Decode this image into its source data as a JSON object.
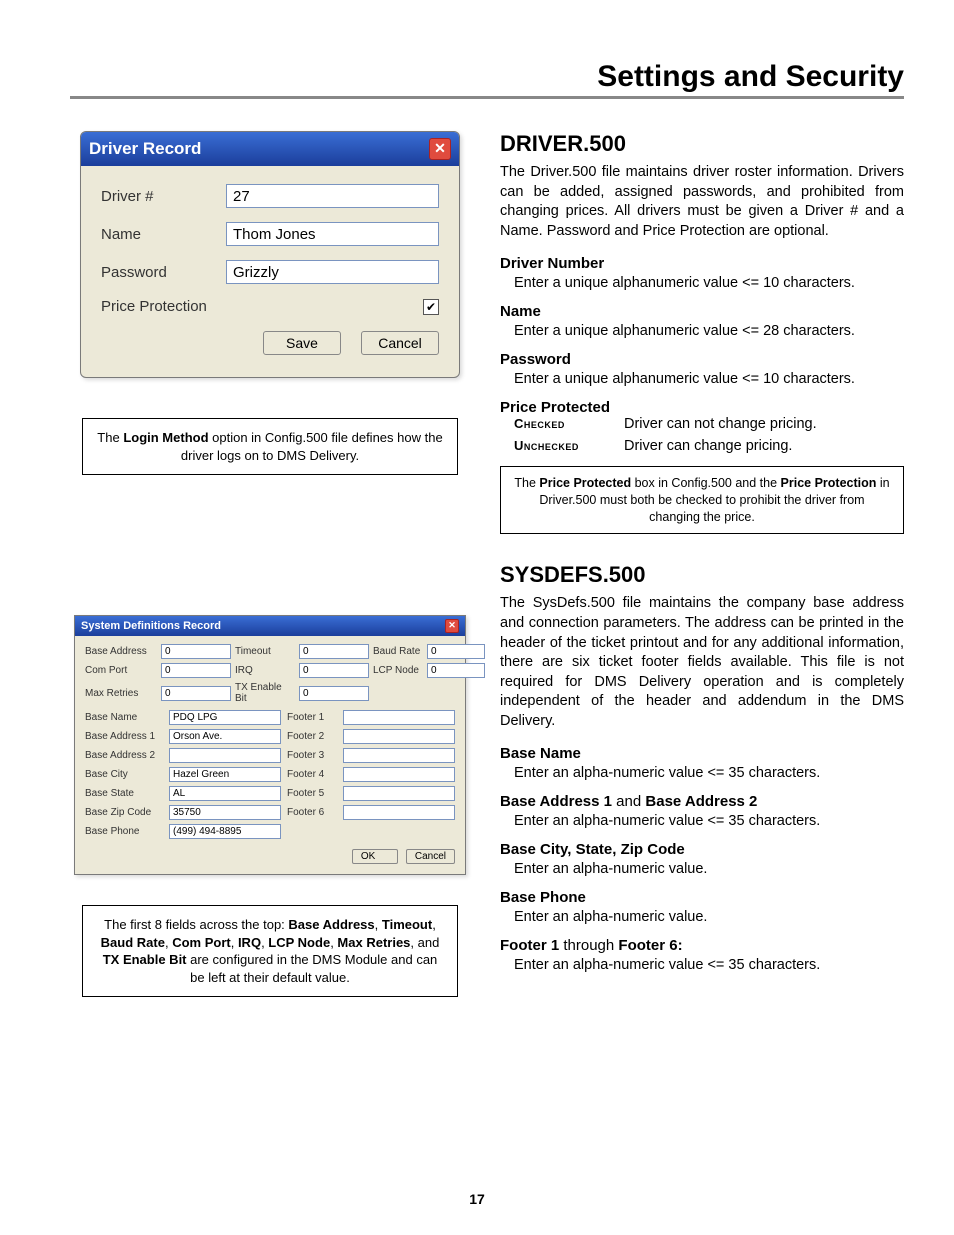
{
  "page": {
    "title": "Settings and Security",
    "number": "17"
  },
  "driverDialog": {
    "title": "Driver Record",
    "fields": {
      "driverNum": {
        "label": "Driver #",
        "value": "27"
      },
      "name": {
        "label": "Name",
        "value": "Thom Jones"
      },
      "password": {
        "label": "Password",
        "value": "Grizzly"
      },
      "priceProtection": {
        "label": "Price Protection",
        "checked": true
      }
    },
    "buttons": {
      "save": "Save",
      "cancel": "Cancel"
    }
  },
  "loginNote": {
    "pre": "The ",
    "bold": "Login Method",
    "post": " option in Config.500 file defines how the driver logs on to DMS Delivery."
  },
  "sysdefsDialog": {
    "title": "System Definitions Record",
    "row1": {
      "baseAddress": {
        "label": "Base Address",
        "value": "0"
      },
      "timeout": {
        "label": "Timeout",
        "value": "0"
      },
      "baudRate": {
        "label": "Baud Rate",
        "value": "0"
      }
    },
    "row2": {
      "comPort": {
        "label": "Com Port",
        "value": "0"
      },
      "irq": {
        "label": "IRQ",
        "value": "0"
      },
      "lcpNode": {
        "label": "LCP Node",
        "value": "0"
      }
    },
    "row3": {
      "maxRetries": {
        "label": "Max Retries",
        "value": "0"
      },
      "txEnableBit": {
        "label": "TX Enable Bit",
        "value": "0"
      }
    },
    "lower": {
      "baseName": {
        "label": "Base Name",
        "value": "PDQ LPG"
      },
      "baseAddr1": {
        "label": "Base Address 1",
        "value": "Orson Ave."
      },
      "baseAddr2": {
        "label": "Base Address 2",
        "value": ""
      },
      "baseCity": {
        "label": "Base City",
        "value": "Hazel Green"
      },
      "baseState": {
        "label": "Base State",
        "value": "AL"
      },
      "baseZip": {
        "label": "Base Zip Code",
        "value": "35750"
      },
      "basePhone": {
        "label": "Base Phone",
        "value": "(499) 494-8895"
      },
      "footer1": {
        "label": "Footer 1",
        "value": ""
      },
      "footer2": {
        "label": "Footer 2",
        "value": ""
      },
      "footer3": {
        "label": "Footer 3",
        "value": ""
      },
      "footer4": {
        "label": "Footer 4",
        "value": ""
      },
      "footer5": {
        "label": "Footer 5",
        "value": ""
      },
      "footer6": {
        "label": "Footer 6",
        "value": ""
      }
    },
    "buttons": {
      "ok": "OK",
      "cancel": "Cancel"
    }
  },
  "sysdefsNote": "The first 8 fields across the top: Base Address, Timeout, Baud Rate, Com Port, IRQ, LCP Node, Max Retries, and TX Enable Bit are configured in the DMS Module and can be left at their default value.",
  "sysdefsNoteBolds": [
    "Base Address",
    "Timeout",
    "Baud Rate",
    "Com Port",
    "IRQ",
    "LCP Node",
    "Max Retries",
    "TX Enable Bit"
  ],
  "right": {
    "driver500": {
      "heading": "DRIVER.500",
      "para": "The Driver.500 file maintains driver roster information. Drivers can be added, assigned passwords, and prohibited from changing prices. All drivers must be given a Driver # and a Name. Password and Price Protection are optional.",
      "items": [
        {
          "h": "Driver Number",
          "t": "Enter a unique alphanumeric value <= 10 characters."
        },
        {
          "h": "Name",
          "t": "Enter a unique alphanumeric value <= 28 characters."
        },
        {
          "h": "Password",
          "t": "Enter a unique alphanumeric value <= 10 characters."
        }
      ],
      "priceProtected": {
        "h": "Price Protected",
        "checked": {
          "k": "Checked",
          "v": "Driver can not change pricing."
        },
        "unchecked": {
          "k": "Unchecked",
          "v": "Driver can change pricing."
        }
      },
      "note": "The Price Protected box in Config.500 and the Price Protection in Driver.500 must both be checked to prohibit the driver from changing the price.",
      "noteBolds": [
        "Price Protected",
        "Price Protection"
      ]
    },
    "sysdefs500": {
      "heading": "SYSDEFS.500",
      "para": "The SysDefs.500 file maintains the company base address and connection parameters. The address can be printed in the header of the ticket printout and for any additional information, there are six ticket footer fields available. This file is not required for DMS Delivery operation and is completely independent of the header and addendum in the DMS Delivery.",
      "items": [
        {
          "h": "Base Name",
          "t": "Enter an alpha-numeric value <= 35 characters."
        },
        {
          "h": "Base Address 1 and Base Address 2",
          "hparts": [
            "Base Address 1",
            " and ",
            "Base Address 2"
          ],
          "t": "Enter an alpha-numeric value <= 35 characters."
        },
        {
          "h": "Base City, State, Zip Code",
          "t": "Enter an alpha-numeric value."
        },
        {
          "h": "Base Phone",
          "t": "Enter an alpha-numeric value."
        },
        {
          "h": "Footer 1 through Footer 6:",
          "hparts": [
            "Footer 1",
            " through ",
            "Footer 6:"
          ],
          "t": "Enter an alpha-numeric value <= 35 characters."
        }
      ]
    }
  }
}
